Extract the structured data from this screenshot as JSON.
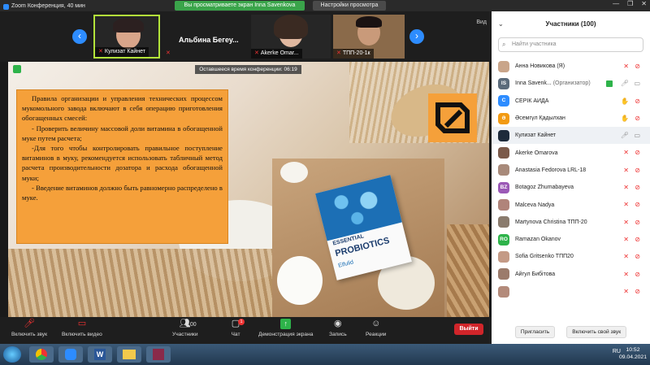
{
  "window": {
    "title": "Zoom Конференция, 40 мин",
    "share_banner": "Вы просматриваете экран Inna Savenkova",
    "view_options": "Настройки просмотра",
    "controls": [
      "—",
      "❐",
      "✕"
    ]
  },
  "video_strip": {
    "prev_icon": "chevron-left-icon",
    "next_icon": "chevron-right-icon",
    "tiles": [
      {
        "name": "Кулизат Кайнет",
        "active": true
      },
      {
        "name": "Альбина  Бегеу...",
        "active": false
      },
      {
        "name": "Akerke Omar...",
        "active": false
      },
      {
        "name": "ТПП-20-1к",
        "active": false
      }
    ],
    "view_label": "Вид"
  },
  "shared_screen": {
    "timer": "Оставшееся время конференции: 06:19",
    "paragraphs": [
      "Правила организации и управления технических процессом мукомольного завода включают в себя операцию приготовления обогащенных смесей:",
      "- Проверить величину массовой доли витамина в обогащенной муке путем расчета;",
      "-Для того чтобы контролировать правильное поступление витаминов в муку, рекомендуется использовать табличный метод расчета производительности дозатора и расхода обогащенной муки;",
      "- Введение витаминов должно быть равномерно распределено в муке."
    ],
    "product": {
      "line1": "ESSENTIAL",
      "line2": "PROBIOTICS",
      "line3": "Elfulid"
    }
  },
  "toolbar": {
    "mic": {
      "label": "Включить звук",
      "icon": "mic-muted-icon"
    },
    "video": {
      "label": "Включить видео",
      "icon": "video-off-icon"
    },
    "participants": {
      "label": "Участники",
      "count": "100",
      "icon": "participants-icon"
    },
    "chat": {
      "label": "Чат",
      "badge": "1",
      "icon": "chat-icon"
    },
    "share": {
      "label": "Демонстрация экрана",
      "icon": "share-screen-icon"
    },
    "record": {
      "label": "Запись",
      "icon": "record-icon"
    },
    "reactions": {
      "label": "Реакции",
      "icon": "reactions-icon"
    },
    "leave": "Выйти"
  },
  "participants_panel": {
    "title": "Участники (100)",
    "search_placeholder": "Найти участника",
    "invite": "Пригласить",
    "unmute_self": "Включить свой звук",
    "items": [
      {
        "name": "Анна Новикова (Я)",
        "initials": "",
        "color": "#c9a58a",
        "mic": "muted",
        "cam": "off"
      },
      {
        "name": "Inna Savenk...",
        "role": "(Организатор)",
        "initials": "IS",
        "color": "#5b6b7b",
        "mic": "on",
        "cam": "on",
        "sharing": true
      },
      {
        "name": "СЕРІК АИДА",
        "initials": "С",
        "color": "#2d8cff",
        "mic": "hand",
        "cam": "off"
      },
      {
        "name": "Әсемгүл Қадылхан",
        "initials": "Ә",
        "color": "#f29a12",
        "mic": "hand",
        "cam": "off"
      },
      {
        "name": "Кулизат Кайнет",
        "initials": "",
        "color": "#1d2a3a",
        "mic": "on",
        "cam": "on",
        "selected": true
      },
      {
        "name": "Akerke Omarova",
        "initials": "",
        "color": "#7b5a4a",
        "mic": "muted",
        "cam": "off"
      },
      {
        "name": "Anastasia Fedorova LRL-18",
        "initials": "",
        "color": "#a88a7a",
        "mic": "muted",
        "cam": "off"
      },
      {
        "name": "Botagoz Zhumabayeva",
        "initials": "BZ",
        "color": "#9b59b6",
        "mic": "muted",
        "cam": "off"
      },
      {
        "name": "Malceva Nadya",
        "initials": "",
        "color": "#b0847a",
        "mic": "muted",
        "cam": "off"
      },
      {
        "name": "Martynova Christina ТПП-20",
        "initials": "",
        "color": "#8a7b6d",
        "mic": "muted",
        "cam": "off"
      },
      {
        "name": "Ramazan Okanov",
        "initials": "RO",
        "color": "#2eb34a",
        "mic": "muted",
        "cam": "off"
      },
      {
        "name": "Sofia Gritsenko ТПП20",
        "initials": "",
        "color": "#c49a86",
        "mic": "muted",
        "cam": "off"
      },
      {
        "name": "Айгул Бибітова",
        "initials": "",
        "color": "#9b7b6b",
        "mic": "muted",
        "cam": "off"
      },
      {
        "name": "",
        "initials": "",
        "color": "#b38a7a",
        "mic": "muted",
        "cam": "off"
      }
    ]
  },
  "taskbar": {
    "apps": [
      "start-icon",
      "chrome-icon",
      "zoom-icon",
      "word-icon",
      "folder-icon",
      "winrar-icon"
    ],
    "lang": "RU",
    "time": "10:52",
    "date": "09.04.2021"
  }
}
